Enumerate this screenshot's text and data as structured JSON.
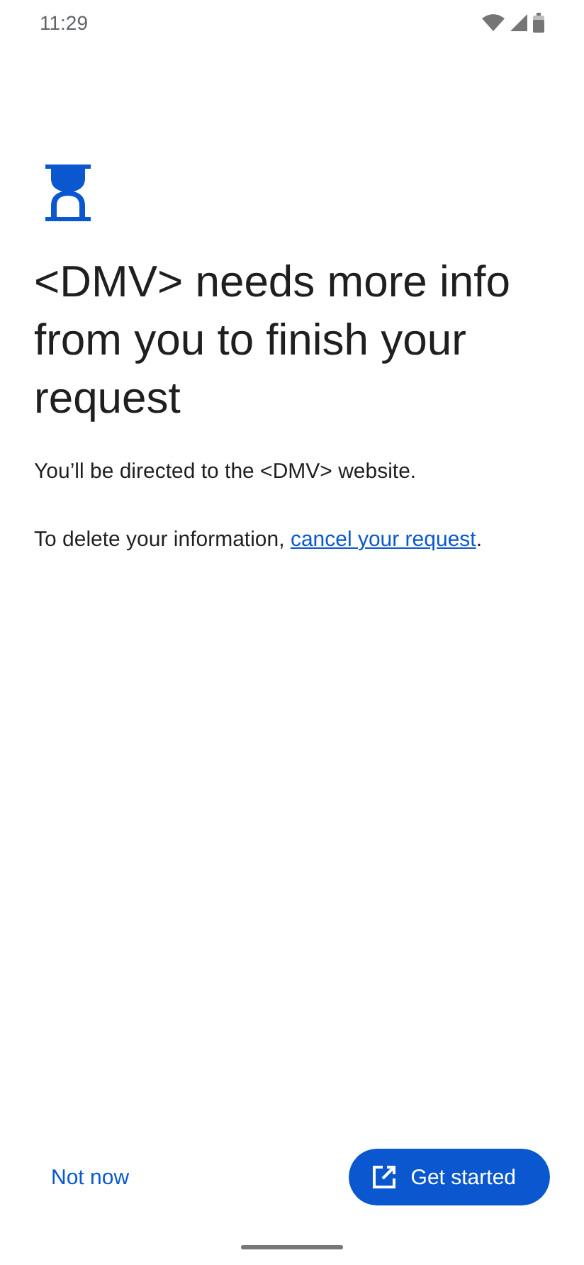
{
  "status_bar": {
    "time": "11:29"
  },
  "title": "<DMV> needs more info from you to finish your request",
  "body": "You’ll be directed to the <DMV> website.",
  "delete_note": {
    "prefix": "To delete your information, ",
    "link": "cancel your request",
    "suffix": "."
  },
  "buttons": {
    "secondary": "Not now",
    "primary": "Get started"
  }
}
